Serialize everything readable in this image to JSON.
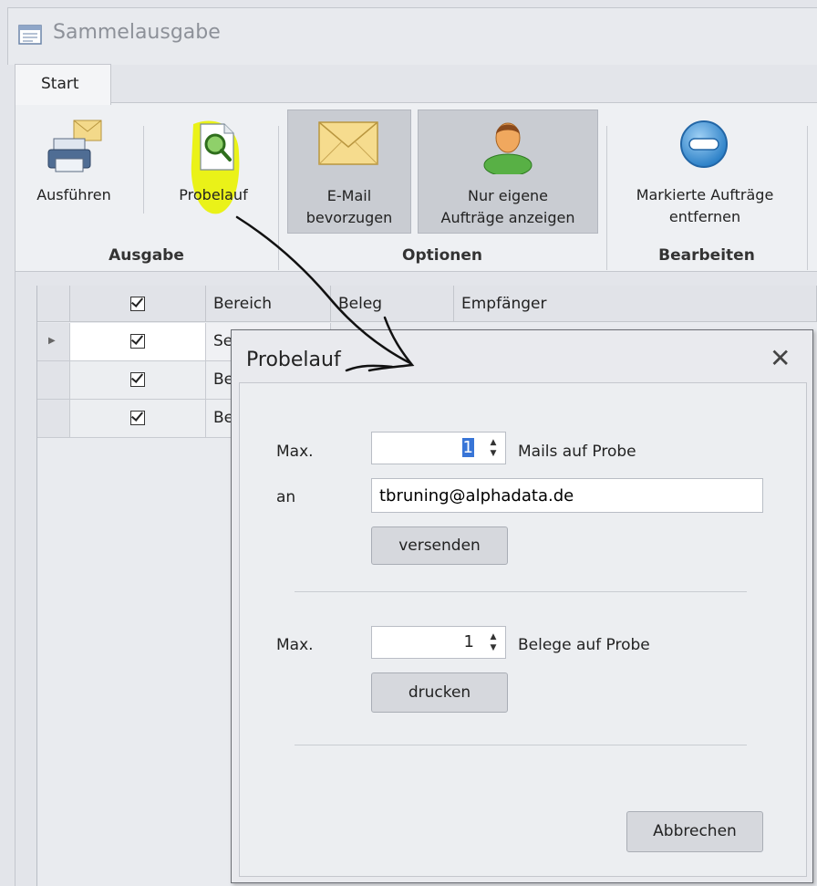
{
  "window": {
    "title": "Sammelausgabe"
  },
  "tabs": [
    {
      "label": "Start"
    }
  ],
  "ribbon": {
    "groups": {
      "ausgabe": "Ausgabe",
      "optionen": "Optionen",
      "bearbeiten": "Bearbeiten"
    },
    "buttons": {
      "ausfuehren": "Ausführen",
      "probelauf": "Probelauf",
      "email_line1": "E-Mail",
      "email_line2": "bevorzugen",
      "eigene_line1": "Nur eigene",
      "eigene_line2": "Aufträge anzeigen",
      "entfernen_line1": "Markierte Aufträge",
      "entfernen_line2": "entfernen"
    }
  },
  "grid": {
    "columns": [
      "",
      "Bereich",
      "Beleg",
      "Empfänger"
    ],
    "rows": [
      {
        "checked": true,
        "bereich": "Se"
      },
      {
        "checked": true,
        "bereich": "Be"
      },
      {
        "checked": true,
        "bereich": "Be"
      }
    ]
  },
  "dialog": {
    "title": "Probelauf",
    "close": "✕",
    "mail": {
      "max_label": "Max.",
      "max_value": "1",
      "suffix": "Mails auf Probe",
      "to_label": "an",
      "to_value": "tbruning@alphadata.de",
      "send_button": "versenden"
    },
    "print": {
      "max_label": "Max.",
      "max_value": "1",
      "suffix": "Belege auf Probe",
      "print_button": "drucken"
    },
    "cancel_button": "Abbrechen"
  },
  "colors": {
    "highlight": "#e9f200",
    "accent_blue": "#3a8fd6"
  }
}
